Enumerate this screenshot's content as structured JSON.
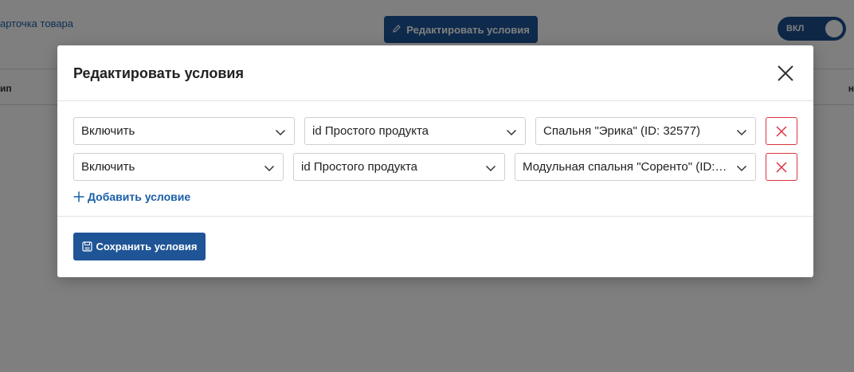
{
  "background": {
    "link_text": "арточка товара",
    "edit_button_label": "Редактировать условия",
    "toggle_label": "ВКЛ",
    "table_head_left": "ип",
    "table_head_right": "н"
  },
  "modal": {
    "title": "Редактировать условия",
    "conditions": [
      {
        "action": "Включить",
        "field": "id Простого продукта",
        "value": "Спальня \"Эрика\" (ID: 32577)"
      },
      {
        "action": "Включить",
        "field": "id Простого продукта",
        "value": "Модульная спальня \"Соренто\" (ID: 3..."
      }
    ],
    "add_condition_label": "Добавить условие",
    "save_button_label": "Сохранить условия"
  },
  "colors": {
    "primary": "#1f5597",
    "link": "#1a5ea8",
    "danger": "#d9333f"
  }
}
